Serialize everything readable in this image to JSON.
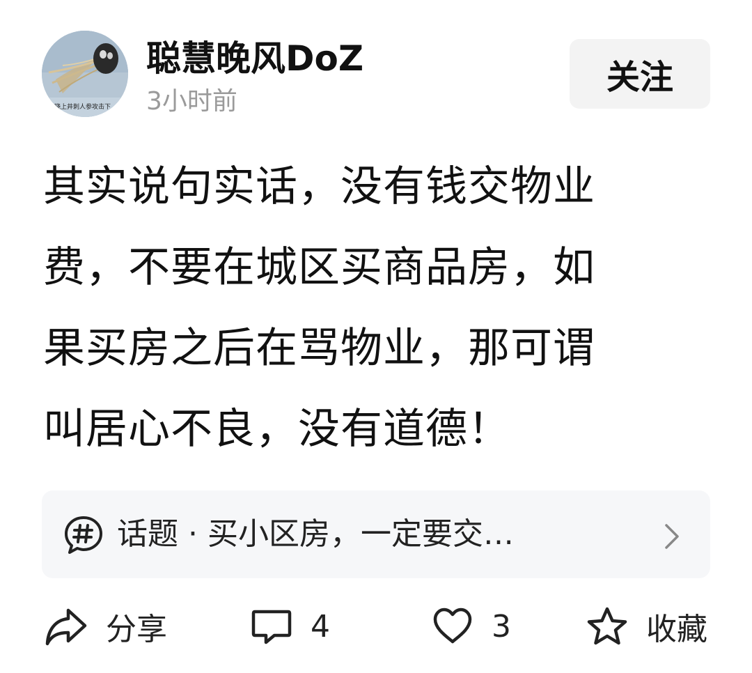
{
  "author": {
    "name": "聪慧晚风DoZ",
    "time": "3小时前",
    "avatar_caption": "晓上井刺人参攻击下"
  },
  "follow_button": {
    "label": "关注"
  },
  "post": {
    "lines": [
      "其实说句实话，没有钱交物业",
      "费，不要在城区买商品房，如",
      "果买房之后在骂物业，那可谓",
      "叫居心不良，没有道德！"
    ]
  },
  "topic": {
    "icon": "hashtag-bubble-icon",
    "text": "话题 · 买小区房，一定要交…"
  },
  "actions": {
    "share": {
      "icon": "share-arrow-icon",
      "label": "分享"
    },
    "comment": {
      "icon": "comment-icon",
      "count": "4"
    },
    "like": {
      "icon": "heart-icon",
      "count": "3"
    },
    "favorite": {
      "icon": "star-icon",
      "label": "收藏"
    }
  },
  "colors": {
    "text": "#111111",
    "secondary_text": "#9a9a9a",
    "follow_bg": "#f3f3f3",
    "topic_bg": "#f6f7f9"
  }
}
